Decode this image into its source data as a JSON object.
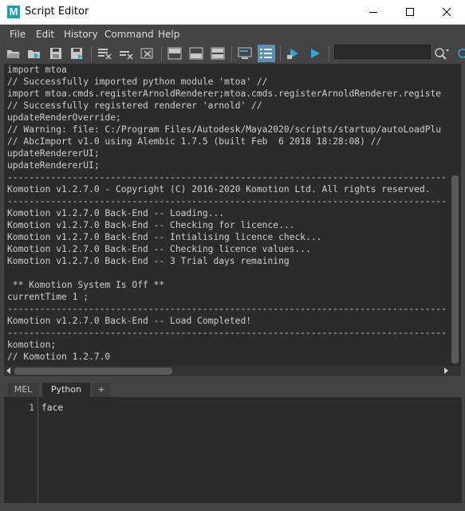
{
  "window": {
    "title": "Script Editor",
    "app_logo_letter": "M"
  },
  "menu": [
    "File",
    "Edit",
    "History",
    "Command",
    "Help"
  ],
  "toolbar": {
    "search_value": ""
  },
  "history": {
    "lines": [
      "import mtoa",
      "// Successfully imported python module 'mtoa' //",
      "import mtoa.cmds.registerArnoldRenderer;mtoa.cmds.registerArnoldRenderer.registe",
      "// Successfully registered renderer 'arnold' //",
      "updateRenderOverride;",
      "// Warning: file: C:/Program Files/Autodesk/Maya2020/scripts/startup/autoLoadPlu",
      "// AbcImport v1.0 using Alembic 1.7.5 (built Feb  6 2018 18:28:08) //",
      "updateRendererUI;",
      "updateRendererUI;",
      "--------------------------------------------------------------------------------------------",
      "Komotion v1.2.7.0 - Copyright (C) 2016-2020 Komotion Ltd. All rights reserved.",
      "--------------------------------------------------------------------------------------------",
      "Komotion v1.2.7.0 Back-End -- Loading...",
      "Komotion v1.2.7.0 Back-End -- Checking for licence...",
      "Komotion v1.2.7.0 Back-End -- Intialising licence check...",
      "Komotion v1.2.7.0 Back-End -- Checking licence values...",
      "Komotion v1.2.7.0 Back-End -- 3 Trial days remaining",
      "",
      " ** Komotion System Is Off **",
      "currentTime 1 ;",
      "--------------------------------------------------------------------------------------------",
      "Komotion v1.2.7.0 Back-End -- Load Completed!",
      "--------------------------------------------------------------------------------------------",
      "komotion;",
      "// Komotion 1.2.7.0"
    ]
  },
  "tabs": [
    {
      "label": "MEL"
    },
    {
      "label": "Python"
    },
    {
      "label": "+"
    }
  ],
  "editor": {
    "line_number": "1",
    "code": "face"
  },
  "colors": {
    "accent": "#5b8fb8",
    "play": "#2aa8d8",
    "warning_text": "#cfcfcf"
  }
}
